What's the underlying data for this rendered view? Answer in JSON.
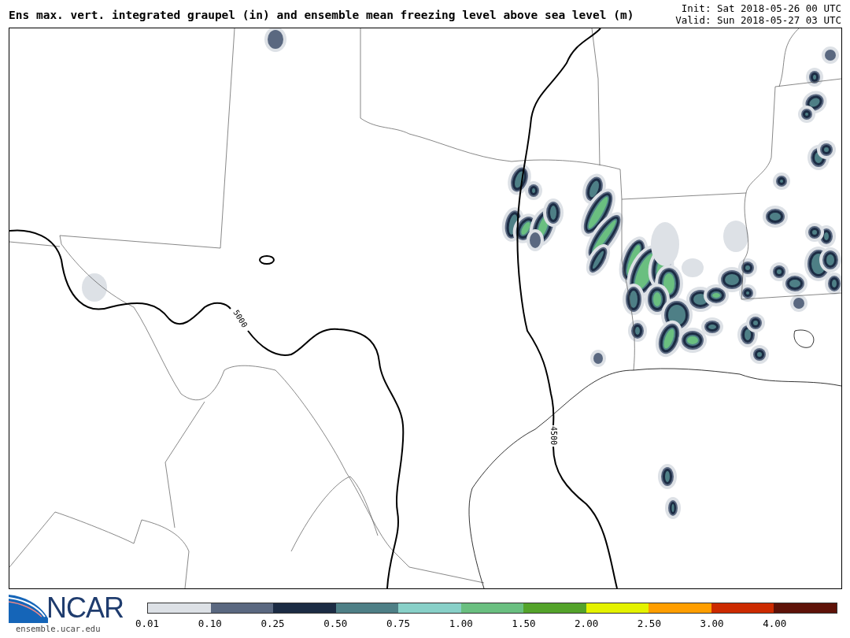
{
  "title": "Ens max. vert. integrated graupel (in) and ensemble mean freezing level above sea level (m)",
  "init": "Init: Sat 2018-05-26 00 UTC",
  "valid": "Valid: Sun 2018-05-27 03 UTC",
  "map": {
    "contour_labels": [
      "5000",
      "4500"
    ]
  },
  "logo": {
    "text": "NCAR",
    "url": "ensemble.ucar.edu"
  },
  "colorbar": {
    "bins": [
      {
        "label": "0.01",
        "color": "#dde1e6"
      },
      {
        "label": "0.10",
        "color": "#5a6880"
      },
      {
        "label": "0.25",
        "color": "#1c2c44"
      },
      {
        "label": "0.50",
        "color": "#4e7f86"
      },
      {
        "label": "0.75",
        "color": "#88d0c8"
      },
      {
        "label": "1.00",
        "color": "#6abf80"
      },
      {
        "label": "1.50",
        "color": "#54a32a"
      },
      {
        "label": "2.00",
        "color": "#e4f200"
      },
      {
        "label": "2.50",
        "color": "#ff9e00"
      },
      {
        "label": "3.00",
        "color": "#cc2a00"
      },
      {
        "label": "4.00",
        "color": "#5e1208"
      }
    ]
  }
}
